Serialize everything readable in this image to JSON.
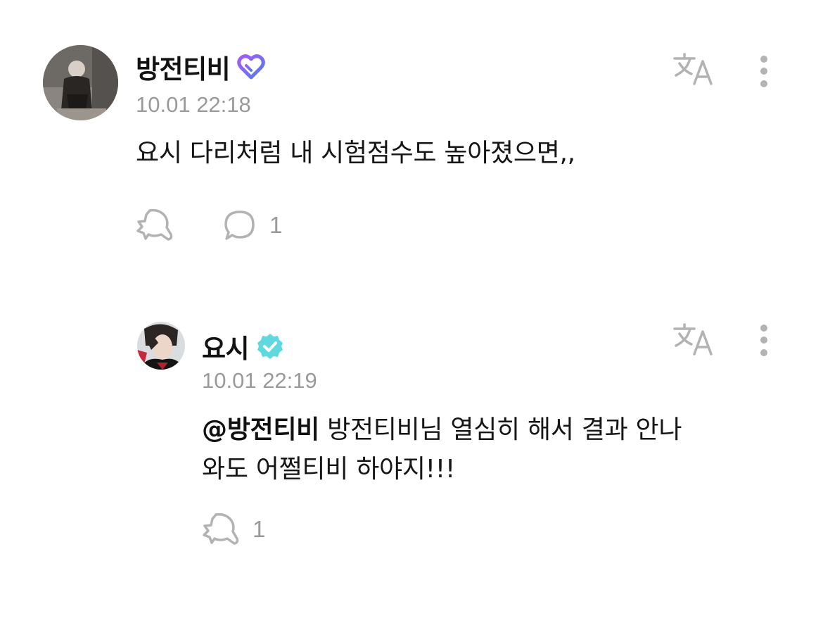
{
  "comments": [
    {
      "author": "방전티비",
      "badge_icon": "fan-heart-badge-icon",
      "timestamp": "10.01 22:18",
      "text": "요시 다리처럼 내 시험점수도 높아졌으면,,",
      "reply_count": "1",
      "like_count": ""
    }
  ],
  "reply": {
    "author": "요시",
    "badge_icon": "verified-badge-icon",
    "timestamp": "10.01 22:19",
    "mention": "@방전티비",
    "text_line1": " 방전티비님 열심히 해서 결과 안나",
    "text_line2": "와도 어쩔티비 하야지!!!",
    "like_count": "1"
  },
  "icons": {
    "translate": "translate-icon",
    "more": "more-vertical-icon",
    "like": "like-icon",
    "reply": "reply-bubble-icon"
  },
  "colors": {
    "icon_gray": "#b3b3b3",
    "fan_badge_blue": "#4f7cf5",
    "fan_badge_purple": "#a45cf2",
    "verified_mint": "#5fd8e0"
  }
}
